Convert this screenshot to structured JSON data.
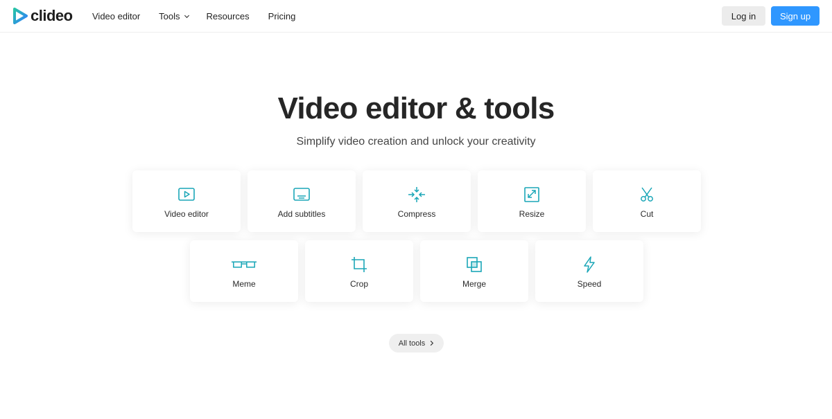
{
  "header": {
    "logo_text": "clideo",
    "nav": {
      "video_editor": "Video editor",
      "tools": "Tools",
      "resources": "Resources",
      "pricing": "Pricing"
    },
    "login_label": "Log in",
    "signup_label": "Sign up"
  },
  "colors": {
    "accent": "#2f97ff",
    "icon": "#1aa6b7",
    "logo_gradient": [
      "#28c3a6",
      "#2f7dff"
    ]
  },
  "hero": {
    "title": "Video editor & tools",
    "subtitle": "Simplify video creation and unlock your creativity"
  },
  "tools": {
    "row1": [
      {
        "label": "Video editor",
        "icon": "play-screen-icon"
      },
      {
        "label": "Add subtitles",
        "icon": "subtitles-icon"
      },
      {
        "label": "Compress",
        "icon": "compress-icon"
      },
      {
        "label": "Resize",
        "icon": "resize-icon"
      },
      {
        "label": "Cut",
        "icon": "scissors-icon"
      }
    ],
    "row2": [
      {
        "label": "Meme",
        "icon": "meme-icon"
      },
      {
        "label": "Crop",
        "icon": "crop-icon"
      },
      {
        "label": "Merge",
        "icon": "merge-icon"
      },
      {
        "label": "Speed",
        "icon": "lightning-icon"
      }
    ]
  },
  "all_tools_label": "All tools"
}
